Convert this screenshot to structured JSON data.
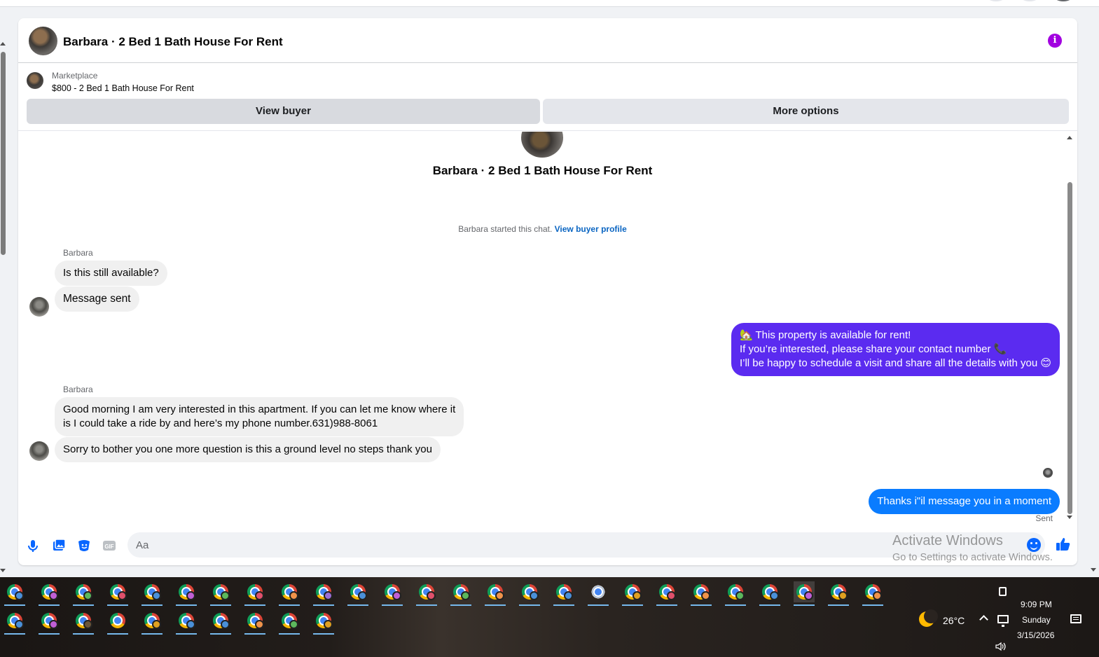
{
  "header": {
    "title": "Barbara · 2 Bed 1 Bath House For Rent",
    "info_icon": "i"
  },
  "listing": {
    "label": "Marketplace",
    "price_title": "$800 - 2 Bed 1 Bath House For Rent",
    "view_buyer": "View buyer",
    "more_options": "More options"
  },
  "conversation": {
    "title": "Barbara · 2 Bed 1 Bath House For Rent",
    "started_text": "Barbara started this chat. ",
    "view_profile": "View buyer profile",
    "messages": [
      {
        "sender": "Barbara",
        "text": "Is this still available?"
      },
      {
        "text": "Message sent"
      },
      {
        "text": "🏡 This property is available for rent!\nIf you’re interested, please share your contact number 📞\nI’ll be happy to schedule a visit and share all the details with you 😊"
      },
      {
        "sender": "Barbara",
        "text": "Good morning I am very interested in this apartment. If you can let me know where it\nis I could take a ride by and here’s my phone number.631)988-8061"
      },
      {
        "text": "Sorry to bother you one more question is this a ground level no steps thank you"
      },
      {
        "text": "Thanks i\"il message you in a moment"
      }
    ],
    "sent_label": "Sent"
  },
  "composer": {
    "placeholder": "Aa"
  },
  "watermark": {
    "line1": "Activate Windows",
    "line2": "Go to Settings to activate Windows."
  },
  "taskbar": {
    "temperature": "26°C",
    "time": "9:09 PM",
    "day": "Sunday",
    "date": "3/15/2026"
  },
  "colors": {
    "accent": "#0866ff",
    "outgoing_purple": "#5b2bf0",
    "outgoing_blue": "#0a7cff",
    "info": "#a200e0"
  }
}
